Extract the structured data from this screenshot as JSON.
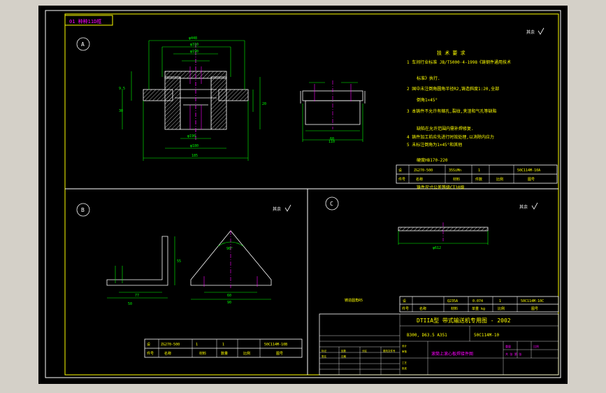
{
  "drawing": {
    "title_tab": "01 种种11D框",
    "roughness_mark": "其余",
    "views": [
      {
        "letter": "A"
      },
      {
        "letter": "B"
      },
      {
        "letter": "C"
      }
    ],
    "dims_a": {
      "d448": "φ448",
      "d310": "φ310",
      "d190": "φ190",
      "d190b": "φ190",
      "d180": "φ180",
      "d185": "185",
      "h95": "9.5",
      "h30": "30",
      "h20": "20"
    },
    "dims_a_right": {
      "w110": "110",
      "w60": "60"
    },
    "dims_b": {
      "w50": "50",
      "h55": "55",
      "w77": "77",
      "w60": "60",
      "w90": "90",
      "ang": "90°"
    },
    "dims_c": {
      "d612": "φ612"
    },
    "tech_title": "技 术 要 求",
    "tech_lines": [
      "1 车间行业标准 JB/T5000·4-1998《铸钢件通用技术",
      "标准》执行.",
      "2 国中未注倒角圆角半径R2,铸造斜度1:20,全部",
      "倒角1×45°",
      "3 本铸件不允许有缩孔,裂纹,夹渣和气孔等缺陷",
      "缺陷在允许范围内需补焊修复.",
      "4 铸件加工前应先进行时效处理,以消除内应力",
      "5 未标注倒角为1×45°和其他",
      "硬度HB170-220",
      "铸件尺寸公差等级CT10级"
    ],
    "small_note": "铸造圆角R5",
    "table_a": {
      "row1": [
        "设",
        "ZG270-500",
        "35SiMn",
        "1",
        "50C114M-10A"
      ],
      "row2": [
        "件号",
        "名称",
        "材料",
        "件数",
        "比例",
        "图号"
      ]
    },
    "table_b": {
      "row1": [
        "设",
        "ZG270-500",
        "1",
        "1",
        "50C114M-10B"
      ],
      "row2": [
        "件号",
        "名称",
        "材料",
        "数量",
        "比例",
        "图号"
      ]
    },
    "table_c": {
      "row1": [
        "设",
        "Q235A",
        "0.074",
        "1",
        "50C114M-10C"
      ],
      "row2": [
        "件号",
        "名称",
        "材料",
        "单重 kg",
        "比例",
        "图号"
      ]
    },
    "title_block": {
      "main_title": "DTIIA型 带式输送机专用图 - 2002",
      "spec": "B300, D63.5 A351",
      "drawing_no": "50C114M-10",
      "part_name": "滚筒上滚心板焊接件图",
      "small_labels": [
        "标记",
        "处数",
        "分区",
        "更改文件号",
        "签名",
        "日期",
        "设计",
        "审核",
        "工艺",
        "批准"
      ],
      "weight_label": "重量",
      "scale_label": "比例",
      "sheet_label": "共 张 第 张"
    }
  }
}
